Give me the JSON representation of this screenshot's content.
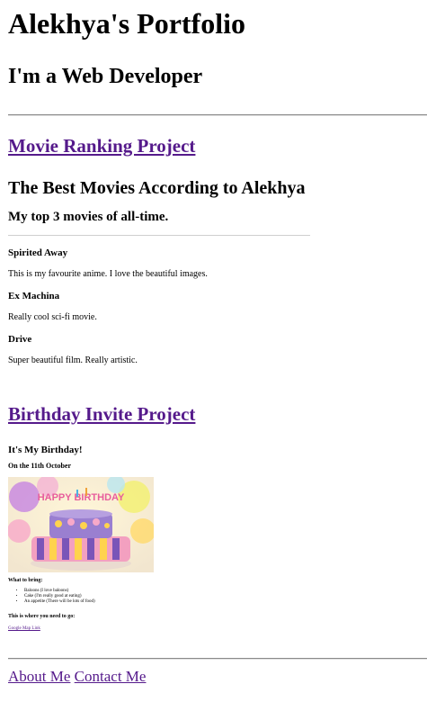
{
  "header": {
    "title": "Alekhya's Portfolio",
    "subtitle": "I'm a Web Developer"
  },
  "projects": {
    "movie_link": "Movie Ranking Project",
    "birthday_link": "Birthday Invite Project"
  },
  "movie": {
    "heading": "The Best Movies According to Alekhya",
    "subheading": "My top 3 movies of all-time.",
    "items": [
      {
        "title": "Spirited Away",
        "desc": "This is my favourite anime. I love the beautiful images."
      },
      {
        "title": "Ex Machina",
        "desc": "Really cool sci-fi movie."
      },
      {
        "title": "Drive",
        "desc": "Super beautiful film. Really artistic."
      }
    ]
  },
  "birthday": {
    "heading": "It's My Birthday!",
    "date": "On the 11th October",
    "cake_text": "HAPPY BIRTHDAY",
    "bring_label": "What to bring:",
    "bring_items": [
      "Baloons (I love baloons)",
      "Cake (I'm really good at eating)",
      "An appetite (There will be lots of food)"
    ],
    "where_label": "This is where you need to go:",
    "map_link": "Google Map Link"
  },
  "footer": {
    "about": "About Me",
    "contact": "Contact Me"
  },
  "colors": {
    "link": "#551a8b",
    "rule": "#8a8a8a"
  }
}
